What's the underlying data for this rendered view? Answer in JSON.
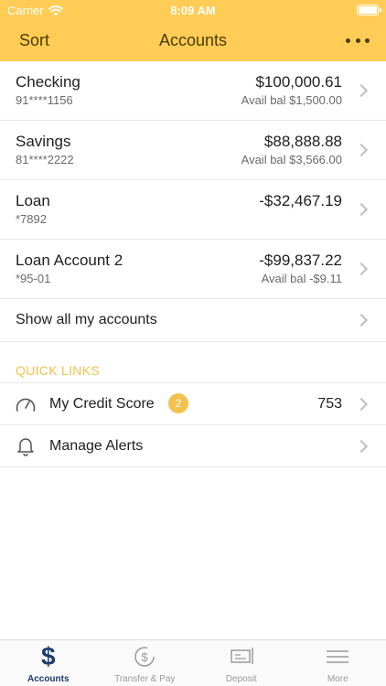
{
  "status_bar": {
    "carrier": "Carrier",
    "time": "8:09 AM"
  },
  "nav": {
    "sort_label": "Sort",
    "title": "Accounts"
  },
  "accounts": [
    {
      "name": "Checking",
      "number": "91****1156",
      "balance": "$100,000.61",
      "available": "Avail bal $1,500.00"
    },
    {
      "name": "Savings",
      "number": "81****2222",
      "balance": "$88,888.88",
      "available": "Avail bal $3,566.00"
    },
    {
      "name": "Loan",
      "number": "*7892",
      "balance": "-$32,467.19",
      "available": ""
    },
    {
      "name": "Loan Account 2",
      "number": "*95-01",
      "balance": "-$99,837.22",
      "available": "Avail bal -$9.11"
    }
  ],
  "show_all_label": "Show all my accounts",
  "quick_links": {
    "header": "QUICK LINKS",
    "credit_score": {
      "label": "My Credit Score",
      "badge": "2",
      "value": "753"
    },
    "alerts": {
      "label": "Manage Alerts"
    }
  },
  "tabs": [
    {
      "label": "Accounts",
      "icon": "dollar-icon"
    },
    {
      "label": "Transfer & Pay",
      "icon": "transfer-icon"
    },
    {
      "label": "Deposit",
      "icon": "check-deposit-icon"
    },
    {
      "label": "More",
      "icon": "menu-icon"
    }
  ],
  "colors": {
    "header": "#ffcc55",
    "accent": "#f2c14e",
    "active_tab": "#1e3a6e"
  }
}
